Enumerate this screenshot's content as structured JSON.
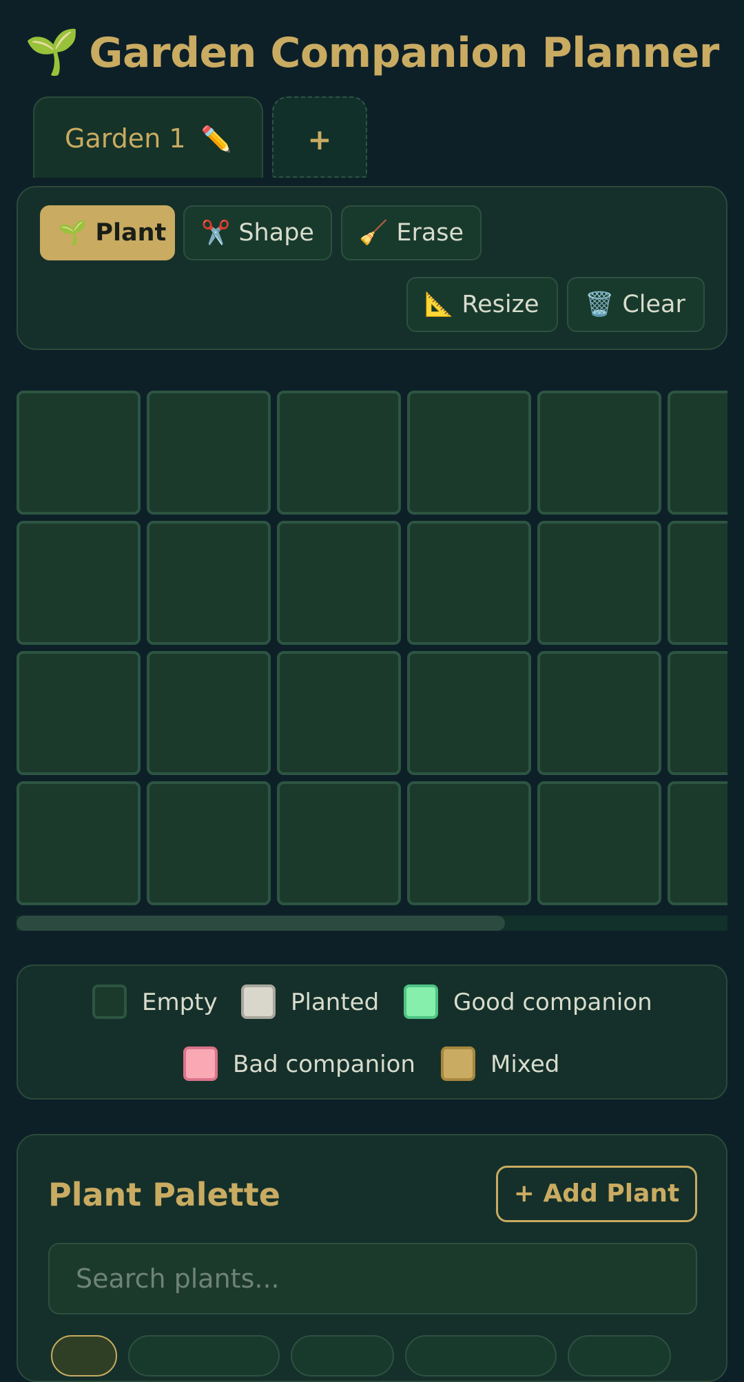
{
  "header": {
    "icon": "sprout-icon",
    "title": "Garden Companion Planner"
  },
  "tabs": [
    {
      "label": "Garden 1",
      "edit_icon": "pencil-icon",
      "active": true
    }
  ],
  "add_tab_label": "+",
  "toolbar": {
    "plant_label": "Plant",
    "shape_label": "Shape",
    "erase_label": "Erase",
    "resize_label": "Resize",
    "clear_label": "Clear",
    "active_tool": "Plant"
  },
  "grid": {
    "visible_rows": 4,
    "visible_columns": 6,
    "cell_state": "Empty",
    "scroll_position": 0
  },
  "legend": {
    "items": [
      {
        "label": "Empty",
        "color": "#1b3a2c"
      },
      {
        "label": "Planted",
        "color": "#d9d7cc"
      },
      {
        "label": "Good companion",
        "color": "#86efac"
      },
      {
        "label": "Bad companion",
        "color": "#f9a8b4"
      },
      {
        "label": "Mixed",
        "color": "#c9ab62"
      }
    ]
  },
  "palette": {
    "title": "Plant Palette",
    "add_button_label": "+ Add Plant",
    "search_placeholder": "Search plants..."
  },
  "colors": {
    "background": "#0d2028",
    "panel": "#15302a",
    "accent": "#c9ab62",
    "text": "#d8dccd"
  }
}
